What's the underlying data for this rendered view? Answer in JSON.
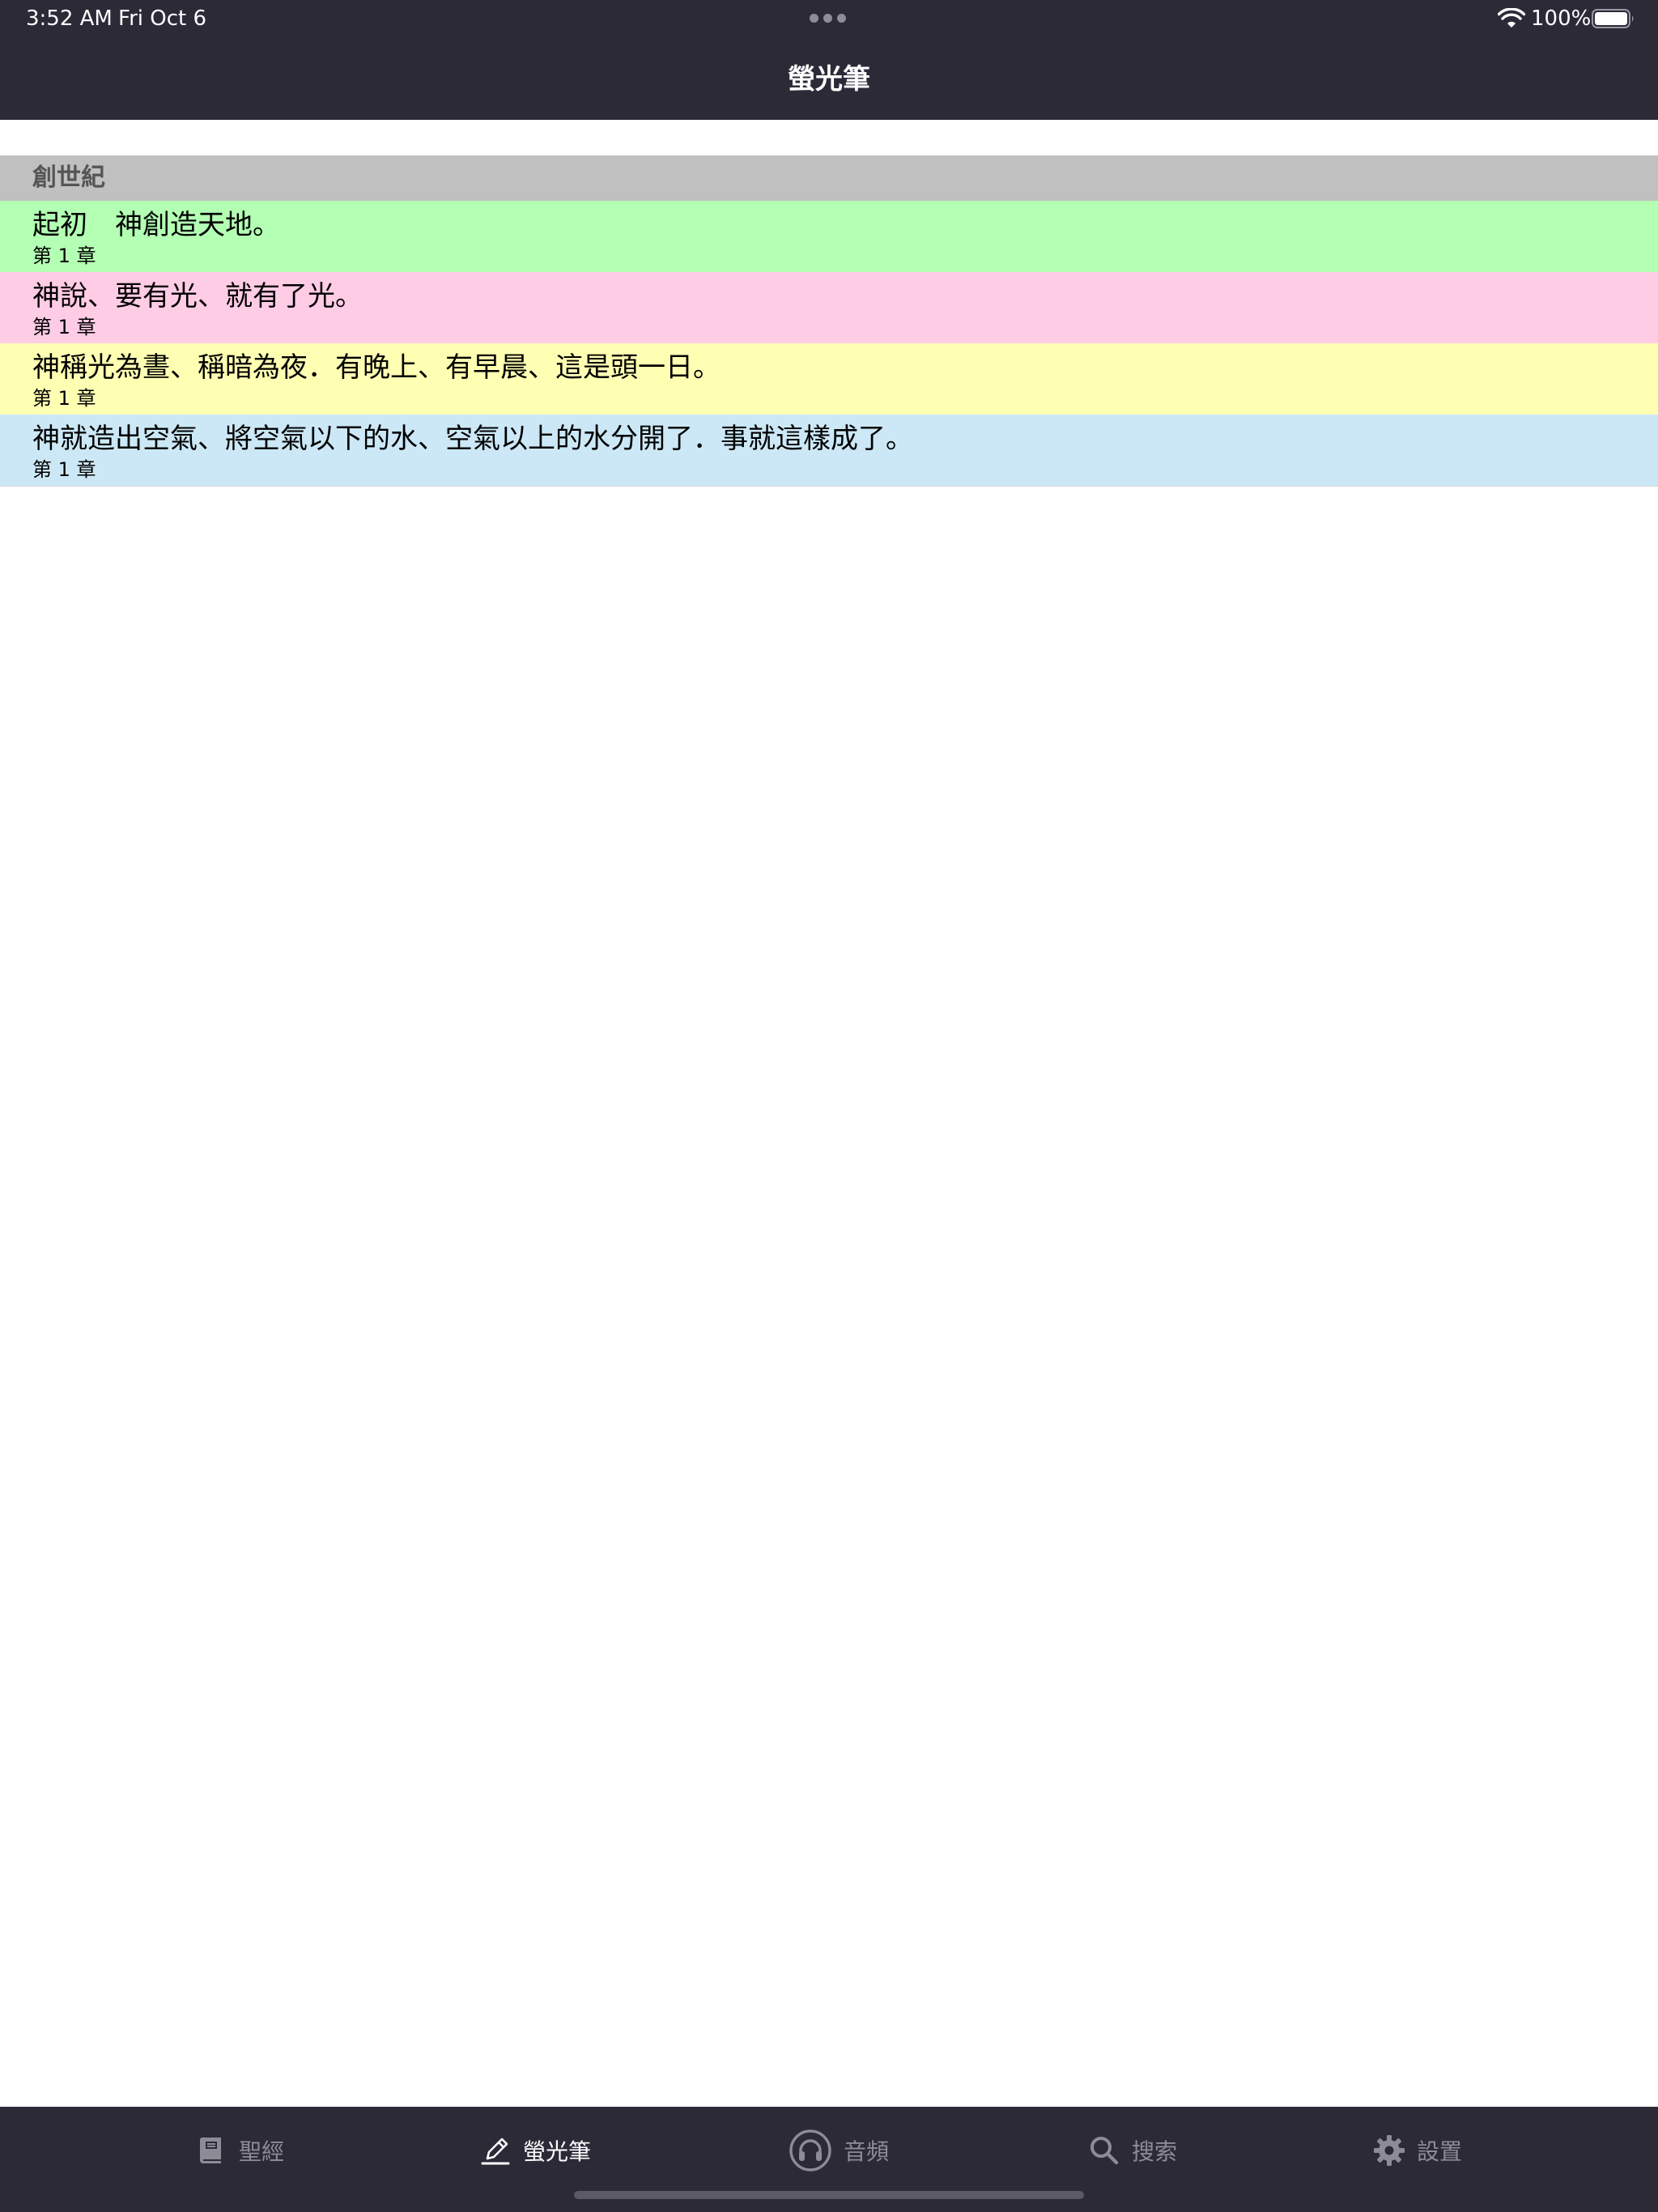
{
  "status_bar": {
    "time": "3:52 AM",
    "date": "Fri Oct 6",
    "battery": "100%"
  },
  "nav": {
    "title": "螢光筆"
  },
  "highlights": {
    "section_title": "創世紀",
    "items": [
      {
        "text": "起初　神創造天地。",
        "chapter": "第 1 章",
        "color": "#b3ffb3"
      },
      {
        "text": "神說、要有光、就有了光。",
        "chapter": "第 1 章",
        "color": "#ffcce6"
      },
      {
        "text": "神稱光為晝、稱暗為夜．有晚上、有早晨、這是頭一日。",
        "chapter": "第 1 章",
        "color": "#ffffb3"
      },
      {
        "text": "神就造出空氣、將空氣以下的水、空氣以上的水分開了．事就這樣成了。",
        "chapter": "第 1 章",
        "color": "#cce8f6"
      }
    ]
  },
  "tab_bar": {
    "bible": "聖經",
    "highlighter": "螢光筆",
    "audio": "音頻",
    "search": "搜索",
    "settings": "設置",
    "active_color": "#ffffff",
    "inactive_color": "#8d8b95"
  }
}
